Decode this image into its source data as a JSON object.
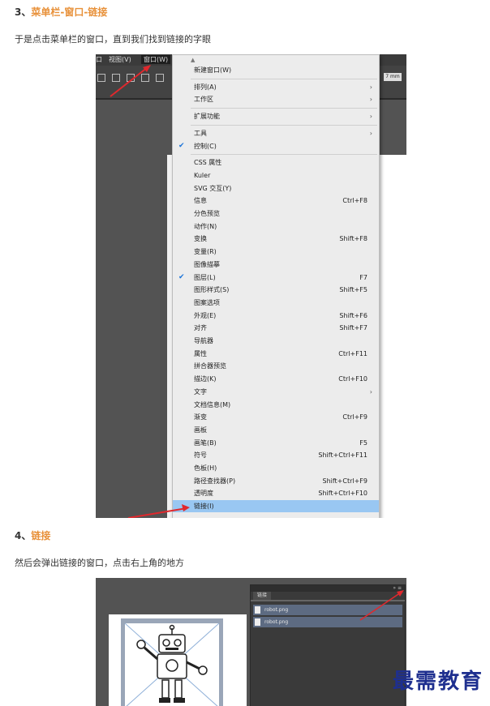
{
  "step3": {
    "number": "3、",
    "title": "菜单栏-窗口-链接",
    "desc": "于是点击菜单栏的窗口，直到我们找到链接的字眼"
  },
  "step4": {
    "number": "4、",
    "title": "链接",
    "desc": "然后会弹出链接的窗口，点击右上角的地方"
  },
  "app_menubar": {
    "view": "视图(V)",
    "window": "窗口(W)"
  },
  "toolbar": {
    "unit_field": "7 mm"
  },
  "window_menu": {
    "items": [
      {
        "label": "新建窗口(W)",
        "shortcut": "",
        "submenu": false,
        "checked": false
      },
      {
        "label": "排列(A)",
        "shortcut": "",
        "submenu": true,
        "checked": false
      },
      {
        "label": "工作区",
        "shortcut": "",
        "submenu": true,
        "checked": false
      },
      {
        "label": "扩展功能",
        "shortcut": "",
        "submenu": true,
        "checked": false
      },
      {
        "label": "工具",
        "shortcut": "",
        "submenu": true,
        "checked": false
      },
      {
        "label": "控制(C)",
        "shortcut": "",
        "submenu": false,
        "checked": true
      },
      {
        "label": "CSS 属性",
        "shortcut": "",
        "submenu": false,
        "checked": false
      },
      {
        "label": "Kuler",
        "shortcut": "",
        "submenu": false,
        "checked": false
      },
      {
        "label": "SVG 交互(Y)",
        "shortcut": "",
        "submenu": false,
        "checked": false
      },
      {
        "label": "信息",
        "shortcut": "Ctrl+F8",
        "submenu": false,
        "checked": false
      },
      {
        "label": "分色预览",
        "shortcut": "",
        "submenu": false,
        "checked": false
      },
      {
        "label": "动作(N)",
        "shortcut": "",
        "submenu": false,
        "checked": false
      },
      {
        "label": "变换",
        "shortcut": "Shift+F8",
        "submenu": false,
        "checked": false
      },
      {
        "label": "变量(R)",
        "shortcut": "",
        "submenu": false,
        "checked": false
      },
      {
        "label": "图像描摹",
        "shortcut": "",
        "submenu": false,
        "checked": false
      },
      {
        "label": "图层(L)",
        "shortcut": "F7",
        "submenu": false,
        "checked": true
      },
      {
        "label": "图形样式(S)",
        "shortcut": "Shift+F5",
        "submenu": false,
        "checked": false
      },
      {
        "label": "图案选项",
        "shortcut": "",
        "submenu": false,
        "checked": false
      },
      {
        "label": "外观(E)",
        "shortcut": "Shift+F6",
        "submenu": false,
        "checked": false
      },
      {
        "label": "对齐",
        "shortcut": "Shift+F7",
        "submenu": false,
        "checked": false
      },
      {
        "label": "导航器",
        "shortcut": "",
        "submenu": false,
        "checked": false
      },
      {
        "label": "属性",
        "shortcut": "Ctrl+F11",
        "submenu": false,
        "checked": false
      },
      {
        "label": "拼合器预览",
        "shortcut": "",
        "submenu": false,
        "checked": false
      },
      {
        "label": "描边(K)",
        "shortcut": "Ctrl+F10",
        "submenu": false,
        "checked": false
      },
      {
        "label": "文字",
        "shortcut": "",
        "submenu": true,
        "checked": false
      },
      {
        "label": "文档信息(M)",
        "shortcut": "",
        "submenu": false,
        "checked": false
      },
      {
        "label": "渐变",
        "shortcut": "Ctrl+F9",
        "submenu": false,
        "checked": false
      },
      {
        "label": "画板",
        "shortcut": "",
        "submenu": false,
        "checked": false
      },
      {
        "label": "画笔(B)",
        "shortcut": "F5",
        "submenu": false,
        "checked": false
      },
      {
        "label": "符号",
        "shortcut": "Shift+Ctrl+F11",
        "submenu": false,
        "checked": false
      },
      {
        "label": "色板(H)",
        "shortcut": "",
        "submenu": false,
        "checked": false
      },
      {
        "label": "路径查找器(P)",
        "shortcut": "Shift+Ctrl+F9",
        "submenu": false,
        "checked": false
      },
      {
        "label": "透明度",
        "shortcut": "Shift+Ctrl+F10",
        "submenu": false,
        "checked": false
      },
      {
        "label": "链接(I)",
        "shortcut": "",
        "submenu": false,
        "checked": false,
        "highlighted": true
      }
    ]
  },
  "links_panel": {
    "tab": "链接",
    "files": [
      "robot.png",
      "robot.png"
    ]
  },
  "watermark": "最需教育",
  "colors": {
    "accent": "#e8913a",
    "arrow": "#e0282d",
    "menu_highlight": "#99c7f2",
    "check": "#1a73d9",
    "watermark": "#1e2f8f"
  }
}
